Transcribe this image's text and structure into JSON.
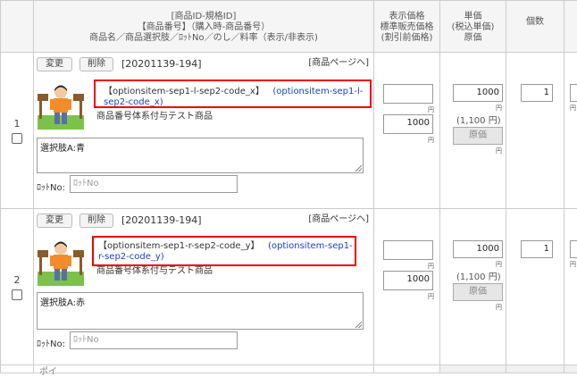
{
  "header": {
    "col_info": [
      "[商品ID-規格ID]",
      "【商品番号】（購入時-商品番号）",
      "商品名／商品選択肢／ﾛｯﾄNo／のし／料率（表示/非表示)"
    ],
    "col_display_price": [
      "表示価格",
      "標準販売価格",
      "(割引前価格)"
    ],
    "col_unit_price": [
      "単価",
      "(税込単価)",
      "原価"
    ],
    "col_qty": [
      "個数"
    ]
  },
  "rows": [
    {
      "index": "1",
      "change_label": "変更",
      "delete_label": "削除",
      "product_code": "[20201139-194]",
      "product_page_link": "[商品ページへ]",
      "title_part1": "【optionsitem-sep1-l-sep2-code_x】",
      "title_part2": "(optionsitem-sep1-l-sep2-code_x)",
      "product_name": "商品番号体系付与テスト商品",
      "option_text": "選択肢A:青",
      "lot_label": "ﾛｯﾄNo:",
      "lot_placeholder": "ﾛｯﾄNo",
      "display_price": "",
      "standard_price": "1000",
      "unit_price": "1000",
      "tax_included": "(1,100 円)",
      "cost_placeholder": "原価",
      "quantity": "1",
      "yen": "円"
    },
    {
      "index": "2",
      "change_label": "変更",
      "delete_label": "削除",
      "product_code": "[20201139-194]",
      "product_page_link": "[商品ページへ]",
      "title_part1": "【optionsitem-sep1-r-sep2-code_y】",
      "title_part2": "(optionsitem-sep1-r-sep2-code_y)",
      "product_name": "商品番号体系付与テスト商品",
      "option_text": "選択肢A:赤",
      "lot_label": "ﾛｯﾄNo:",
      "lot_placeholder": "ﾛｯﾄNo",
      "display_price": "",
      "standard_price": "1000",
      "unit_price": "1000",
      "tax_included": "(1,100 円)",
      "cost_placeholder": "原価",
      "quantity": "1",
      "yen": "円"
    }
  ],
  "footer_partial": "ポイ"
}
